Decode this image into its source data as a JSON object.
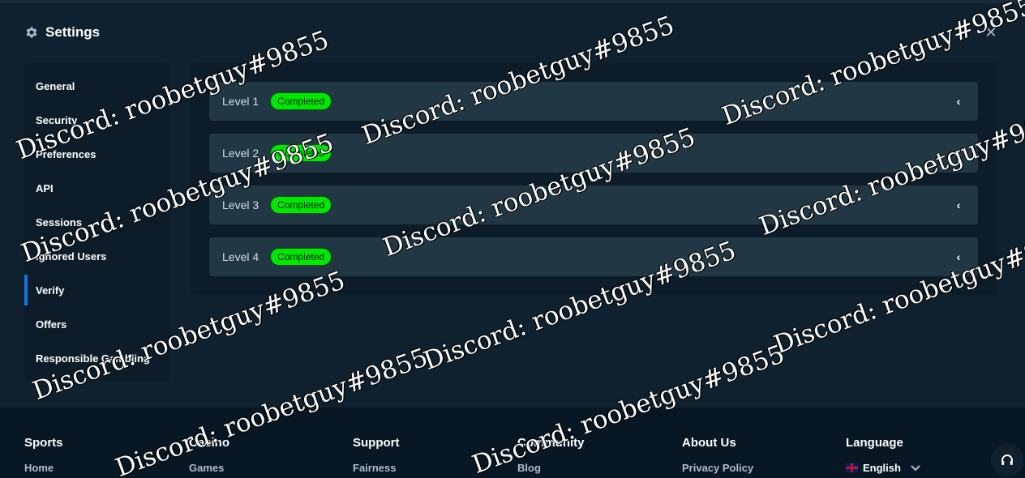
{
  "header": {
    "title": "Settings"
  },
  "sidebar": {
    "items": [
      {
        "label": "General"
      },
      {
        "label": "Security"
      },
      {
        "label": "Preferences"
      },
      {
        "label": "API"
      },
      {
        "label": "Sessions"
      },
      {
        "label": "Ignored Users"
      },
      {
        "label": "Verify"
      },
      {
        "label": "Offers"
      },
      {
        "label": "Responsible Gambling"
      }
    ]
  },
  "levels": [
    {
      "name": "Level 1",
      "status": "Completed"
    },
    {
      "name": "Level 2",
      "status": "Completed"
    },
    {
      "name": "Level 3",
      "status": "Completed"
    },
    {
      "name": "Level 4",
      "status": "Completed"
    }
  ],
  "footer": {
    "columns": [
      {
        "heading": "Sports",
        "link": "Home"
      },
      {
        "heading": "Casino",
        "link": "Games"
      },
      {
        "heading": "Support",
        "link": "Fairness"
      },
      {
        "heading": "Community",
        "link": "Blog"
      },
      {
        "heading": "About Us",
        "link": "Privacy Policy"
      },
      {
        "heading": "Language",
        "link": "English"
      }
    ]
  },
  "watermark": {
    "text": "Discord: roobetguy#9855"
  },
  "colors": {
    "background": "#0f212e",
    "panel": "#0c1d29",
    "row": "#213743",
    "accent": "#1475e1",
    "success": "#00e701"
  }
}
